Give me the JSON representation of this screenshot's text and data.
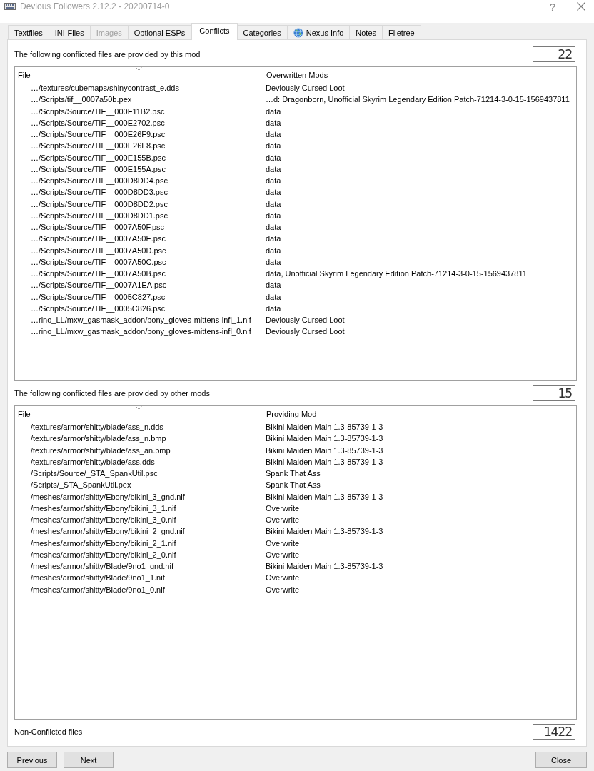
{
  "window": {
    "title": "Devious Followers 2.12.2 - 20200714-0",
    "help": "?"
  },
  "tabs": [
    {
      "label": "Textfiles",
      "selected": false,
      "disabled": false,
      "has_icon": false
    },
    {
      "label": "INI-Files",
      "selected": false,
      "disabled": false,
      "has_icon": false
    },
    {
      "label": "Images",
      "selected": false,
      "disabled": true,
      "has_icon": false
    },
    {
      "label": "Optional ESPs",
      "selected": false,
      "disabled": false,
      "has_icon": false
    },
    {
      "label": "Conflicts",
      "selected": true,
      "disabled": false,
      "has_icon": false
    },
    {
      "label": "Categories",
      "selected": false,
      "disabled": false,
      "has_icon": false
    },
    {
      "label": "Nexus Info",
      "selected": false,
      "disabled": false,
      "has_icon": true
    },
    {
      "label": "Notes",
      "selected": false,
      "disabled": false,
      "has_icon": false
    },
    {
      "label": "Filetree",
      "selected": false,
      "disabled": false,
      "has_icon": false
    }
  ],
  "sections": [
    {
      "label": "The following conflicted files are provided by this mod",
      "count": "22",
      "table": {
        "columns": [
          {
            "label": "File",
            "sorted": true
          },
          {
            "label": "Overwritten Mods",
            "sorted": false
          }
        ],
        "rows": [
          [
            "…/textures/cubemaps/shinycontrast_e.dds",
            "Deviously Cursed Loot"
          ],
          [
            "…/Scripts/tif__0007a50b.pex",
            "…d: Dragonborn, Unofficial Skyrim Legendary Edition Patch-71214-3-0-15-1569437811"
          ],
          [
            "…/Scripts/Source/TIF__000F11B2.psc",
            "data"
          ],
          [
            "…/Scripts/Source/TIF__000E2702.psc",
            "data"
          ],
          [
            "…/Scripts/Source/TIF__000E26F9.psc",
            "data"
          ],
          [
            "…/Scripts/Source/TIF__000E26F8.psc",
            "data"
          ],
          [
            "…/Scripts/Source/TIF__000E155B.psc",
            "data"
          ],
          [
            "…/Scripts/Source/TIF__000E155A.psc",
            "data"
          ],
          [
            "…/Scripts/Source/TIF__000D8DD4.psc",
            "data"
          ],
          [
            "…/Scripts/Source/TIF__000D8DD3.psc",
            "data"
          ],
          [
            "…/Scripts/Source/TIF__000D8DD2.psc",
            "data"
          ],
          [
            "…/Scripts/Source/TIF__000D8DD1.psc",
            "data"
          ],
          [
            "…/Scripts/Source/TIF__0007A50F.psc",
            "data"
          ],
          [
            "…/Scripts/Source/TIF__0007A50E.psc",
            "data"
          ],
          [
            "…/Scripts/Source/TIF__0007A50D.psc",
            "data"
          ],
          [
            "…/Scripts/Source/TIF__0007A50C.psc",
            "data"
          ],
          [
            "…/Scripts/Source/TIF__0007A50B.psc",
            "data, Unofficial Skyrim Legendary Edition Patch-71214-3-0-15-1569437811"
          ],
          [
            "…/Scripts/Source/TIF__0007A1EA.psc",
            "data"
          ],
          [
            "…/Scripts/Source/TIF__0005C827.psc",
            "data"
          ],
          [
            "…/Scripts/Source/TIF__0005C826.psc",
            "data"
          ],
          [
            "…rino_LL/mxw_gasmask_addon/pony_gloves-mittens-infl_1.nif",
            "Deviously Cursed Loot"
          ],
          [
            "…rino_LL/mxw_gasmask_addon/pony_gloves-mittens-infl_0.nif",
            "Deviously Cursed Loot"
          ]
        ]
      }
    },
    {
      "label": "The following conflicted files are provided by other mods",
      "count": "15",
      "table": {
        "columns": [
          {
            "label": "File",
            "sorted": true
          },
          {
            "label": "Providing Mod",
            "sorted": false
          }
        ],
        "rows": [
          [
            "/textures/armor/shitty/blade/ass_n.dds",
            "Bikini Maiden Main 1.3-85739-1-3"
          ],
          [
            "/textures/armor/shitty/blade/ass_n.bmp",
            "Bikini Maiden Main 1.3-85739-1-3"
          ],
          [
            "/textures/armor/shitty/blade/ass_an.bmp",
            "Bikini Maiden Main 1.3-85739-1-3"
          ],
          [
            "/textures/armor/shitty/blade/ass.dds",
            "Bikini Maiden Main 1.3-85739-1-3"
          ],
          [
            "/Scripts/Source/_STA_SpankUtil.psc",
            "Spank That Ass"
          ],
          [
            "/Scripts/_STA_SpankUtil.pex",
            "Spank That Ass"
          ],
          [
            "/meshes/armor/shitty/Ebony/bikini_3_gnd.nif",
            "Bikini Maiden Main 1.3-85739-1-3"
          ],
          [
            "/meshes/armor/shitty/Ebony/bikini_3_1.nif",
            "Overwrite"
          ],
          [
            "/meshes/armor/shitty/Ebony/bikini_3_0.nif",
            "Overwrite"
          ],
          [
            "/meshes/armor/shitty/Ebony/bikini_2_gnd.nif",
            "Bikini Maiden Main 1.3-85739-1-3"
          ],
          [
            "/meshes/armor/shitty/Ebony/bikini_2_1.nif",
            "Overwrite"
          ],
          [
            "/meshes/armor/shitty/Ebony/bikini_2_0.nif",
            "Overwrite"
          ],
          [
            "/meshes/armor/shitty/Blade/9no1_gnd.nif",
            "Bikini Maiden Main 1.3-85739-1-3"
          ],
          [
            "/meshes/armor/shitty/Blade/9no1_1.nif",
            "Overwrite"
          ],
          [
            "/meshes/armor/shitty/Blade/9no1_0.nif",
            "Overwrite"
          ]
        ]
      }
    }
  ],
  "non_conflicted": {
    "label": "Non-Conflicted files",
    "count": "1422"
  },
  "nav_buttons": [
    "Previous",
    "Next"
  ],
  "close_button": "Close"
}
